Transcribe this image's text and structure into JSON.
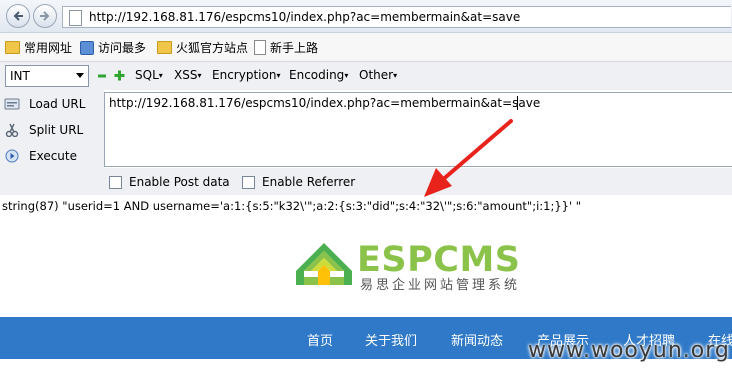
{
  "browser": {
    "url": "http://192.168.81.176/espcms10/index.php?ac=membermain&at=save"
  },
  "bookmarks": [
    {
      "label": "常用网址",
      "icon": "folder-icon"
    },
    {
      "label": "访问最多",
      "icon": "magnifier-icon"
    },
    {
      "label": "火狐官方站点",
      "icon": "folder-icon"
    },
    {
      "label": "新手上路",
      "icon": "page-icon"
    }
  ],
  "hackbar": {
    "encoding_select": "INT",
    "menus": [
      "SQL",
      "XSS",
      "Encryption",
      "Encoding",
      "Other"
    ],
    "buttons": [
      "Load URL",
      "Split URL",
      "Execute"
    ],
    "url_value": "http://192.168.81.176/espcms10/index.php?ac=membermain&at=save",
    "enable_post": "Enable Post data",
    "enable_referrer": "Enable Referrer"
  },
  "output": {
    "text": "string(87) \"userid=1 AND username='a:1:{s:5:\"k32\\'\";a:2:{s:3:\"did\";s:4:\"32\\'\";s:6:\"amount\";i:1;}}' \""
  },
  "site": {
    "logo_text": "ESPCMS",
    "logo_subtitle": "易思企业网站管理系统",
    "nav": [
      "首页",
      "关于我们",
      "新闻动态",
      "产品展示",
      "人才招聘",
      "在线"
    ]
  },
  "watermark": "www.wooyun.org",
  "colors": {
    "nav_bg": "#2f79c8",
    "logo_green": "#8bc34a",
    "arrow_red": "#e8231c"
  }
}
